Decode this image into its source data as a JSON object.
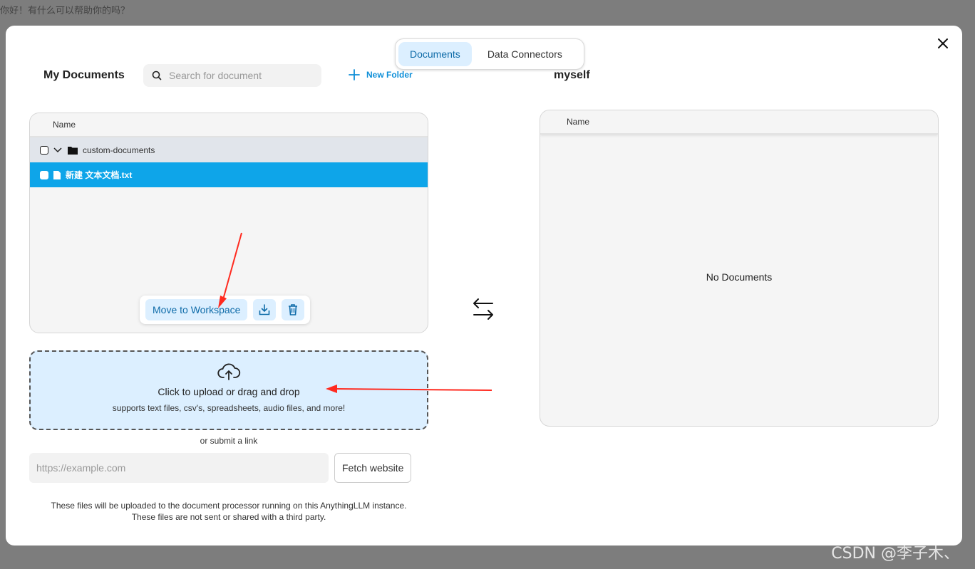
{
  "background": {
    "chat_text": "你好！有什么可以帮助你的吗？"
  },
  "watermark": "CSDN @李子木、",
  "tabs": [
    {
      "label": "Documents",
      "active": true
    },
    {
      "label": "Data Connectors",
      "active": false
    }
  ],
  "left": {
    "title": "My Documents",
    "search_placeholder": "Search for document",
    "new_folder_label": "New Folder",
    "column_name": "Name",
    "folder": {
      "name": "custom-documents",
      "expanded": true,
      "checked": false
    },
    "file": {
      "name": "新建 文本文档.txt",
      "selected": true,
      "checked": false
    },
    "actions": {
      "move_label": "Move to Workspace",
      "save_icon": "download-tray-icon",
      "delete_icon": "trash-icon"
    }
  },
  "upload": {
    "icon": "cloud-upload-icon",
    "title": "Click to upload or drag and drop",
    "subtitle": "supports text files, csv's, spreadsheets, audio files, and more!",
    "or_link": "or submit a link",
    "url_placeholder": "https://example.com",
    "fetch_label": "Fetch website",
    "notice_line1": "These files will be uploaded to the document processor running on this AnythingLLM instance.",
    "notice_line2": "These files are not sent or shared with a third party."
  },
  "right": {
    "title": "myself",
    "column_name": "Name",
    "empty_text": "No Documents"
  },
  "colors": {
    "accent": "#0ea5e9",
    "tab_active_bg": "#dcefff",
    "annotation_arrow": "#ff2a1f"
  }
}
